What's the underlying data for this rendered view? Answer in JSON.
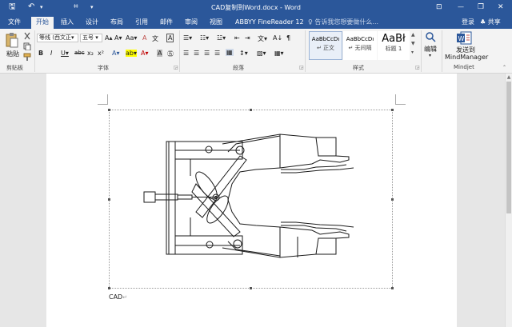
{
  "window": {
    "title": "CAD复制到Word.docx - Word"
  },
  "quick_access": {
    "save": "🖫",
    "undo": "↶",
    "undo_arrow": "▾",
    "touch": "⌗",
    "customize": "▾"
  },
  "window_controls": {
    "ribbon_opts": "⊡",
    "minimize": "—",
    "restore": "❐",
    "close": "✕"
  },
  "tabs": [
    {
      "label": "文件"
    },
    {
      "label": "开始"
    },
    {
      "label": "插入"
    },
    {
      "label": "设计"
    },
    {
      "label": "布局"
    },
    {
      "label": "引用"
    },
    {
      "label": "邮件"
    },
    {
      "label": "审阅"
    },
    {
      "label": "视图"
    },
    {
      "label": "ABBYY FineReader 12"
    }
  ],
  "tell_me": {
    "placeholder": "♀ 告诉我您想要做什么..."
  },
  "account": {
    "login": "登录",
    "share": "♣ 共享"
  },
  "ribbon": {
    "clipboard": {
      "paste": "粘贴",
      "label": "剪贴板"
    },
    "font": {
      "name": "等线 (西文正▾",
      "size": "五号 ▾",
      "grow": "A▴",
      "shrink": "A▾",
      "case": "Aa▾",
      "clear": "A",
      "wen": "文",
      "border_char": "A",
      "bold": "B",
      "italic": "I",
      "underline": "U▾",
      "strike": "abc",
      "sub": "x₂",
      "sup": "x²",
      "effects": "A▾",
      "highlight": "ab▾",
      "color": "A▾",
      "shade": "A",
      "circle": "㊄",
      "label": "字体"
    },
    "paragraph": {
      "bullets": "☰▾",
      "numbering": "☷▾",
      "multilevel": "☳▾",
      "outdent": "⇤",
      "indent": "⇥",
      "chinese": "文▾",
      "sort": "A↓",
      "marks": "¶",
      "align_left": "☰",
      "center": "☰",
      "align_right": "☰",
      "justify": "☰",
      "distribute": "▦",
      "spacing": "↕▾",
      "shading": "▧▾",
      "borders": "▦▾",
      "label": "段落"
    },
    "styles": {
      "items": [
        {
          "sample": "AaBbCcDı",
          "name": "↵ 正文"
        },
        {
          "sample": "AaBbCcDı",
          "name": "↵ 无间隔"
        },
        {
          "sample": "AaBł",
          "name": "标题 1"
        }
      ],
      "label": "样式"
    },
    "editing": {
      "label": "编辑"
    },
    "mindjet": {
      "send": "发送到",
      "app": "MindManager",
      "label": "Mindjet"
    }
  },
  "document": {
    "caption": "CAD",
    "para_mark": "↵"
  },
  "scrollbar": {
    "up": "▲"
  }
}
